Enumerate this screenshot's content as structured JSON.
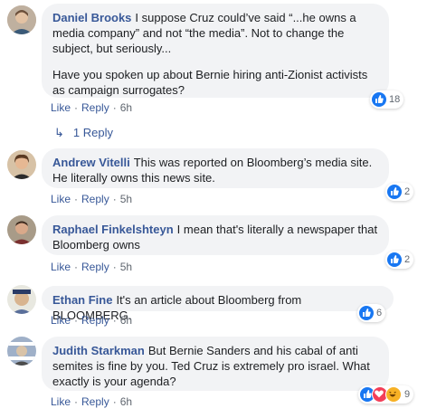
{
  "comments": [
    {
      "author": "Daniel Brooks",
      "text": "I suppose Cruz could’ve said “...he owns a media company” and not “the media”. Not to change the subject, but seriously...",
      "text2": "Have you spoken up about Bernie hiring anti-Zionist activists as campaign surrogates?",
      "like_label": "Like",
      "reply_label": "Reply",
      "time": "6h",
      "reactions": "18",
      "replies_label": "1 Reply"
    },
    {
      "author": "Andrew Vitelli",
      "text": "This was reported on Bloomberg’s media site. He literally owns this news site.",
      "like_label": "Like",
      "reply_label": "Reply",
      "time": "5h",
      "reactions": "2"
    },
    {
      "author": "Raphael Finkelshteyn",
      "text": "I mean that's literally a newspaper that Bloomberg owns",
      "like_label": "Like",
      "reply_label": "Reply",
      "time": "5h",
      "reactions": "2"
    },
    {
      "author": "Ethan Fine",
      "text": "It's an article about Bloomberg from BLOOMBERG.",
      "like_label": "Like",
      "reply_label": "Reply",
      "time": "6h",
      "reactions": "6"
    },
    {
      "author": "Judith Starkman",
      "text": "But Bernie Sanders and his cabal of anti semites is fine by you. Ted Cruz is extremely pro israel. What exactly is your agenda?",
      "like_label": "Like",
      "reply_label": "Reply",
      "time": "6h",
      "reactions": "9"
    }
  ],
  "colors": {
    "link": "#385898",
    "bubble": "#f2f3f5",
    "like": "#1877f2",
    "love": "#f33e58",
    "haha": "#f7b125"
  },
  "icons": {
    "like": "thumbs-up-icon",
    "love": "heart-icon",
    "haha": "laughing-face-icon",
    "reply_arrow": "reply-arrow-icon"
  }
}
